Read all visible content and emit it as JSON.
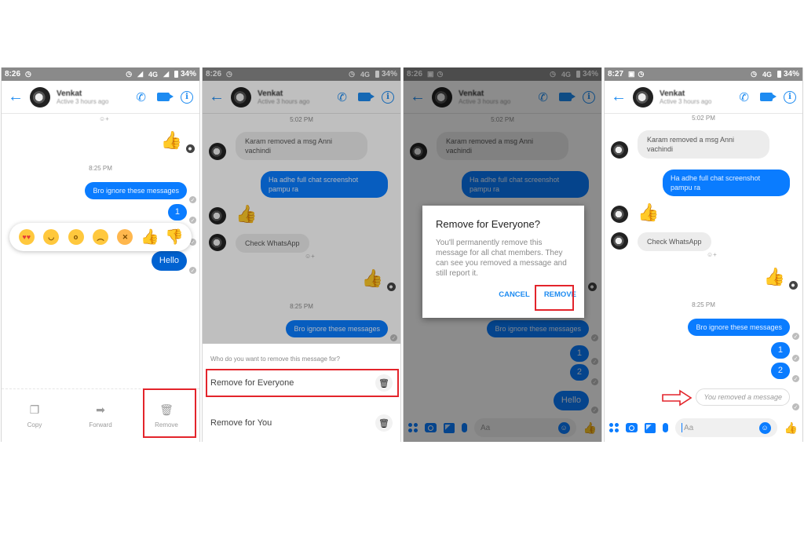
{
  "status_bar": {
    "battery": "34%",
    "network": "4G"
  },
  "contact": {
    "name": "Venkat",
    "status": "Active 3 hours ago"
  },
  "messages": {
    "time_1": "5:02 PM",
    "time_2": "8:25 PM",
    "incoming_1": "Karam removed a msg Anni vachindi",
    "outgoing_1": "Ha adhe full chat screenshot pampu ra",
    "incoming_2": "Check WhatsApp",
    "outgoing_2": "Bro ignore these messages",
    "outgoing_3": "1",
    "outgoing_4": "2",
    "outgoing_5": "Hello",
    "removed_placeholder": "You removed a message"
  },
  "panels": [
    {
      "time": "8:26",
      "reactions": [
        "heart-eyes",
        "laughing",
        "wow",
        "sad",
        "angry",
        "thumbs-up",
        "thumbs-down"
      ],
      "actions": [
        {
          "label": "Copy",
          "icon": "copy-icon"
        },
        {
          "label": "Forward",
          "icon": "forward-icon"
        },
        {
          "label": "Remove",
          "icon": "trash-icon",
          "highlighted": true
        }
      ]
    },
    {
      "time": "8:26",
      "sheet_question": "Who do you want to remove this message for?",
      "options": [
        {
          "label": "Remove for Everyone",
          "highlighted": true
        },
        {
          "label": "Remove for You"
        }
      ]
    },
    {
      "time": "8:26",
      "dialog": {
        "title": "Remove for Everyone?",
        "body": "You'll permanently remove this message for all chat members. They can see you removed a message and still report it.",
        "cancel": "CANCEL",
        "confirm": "REMOVE"
      },
      "composer_placeholder": "Aa"
    },
    {
      "time": "8:27",
      "composer_placeholder": "Aa"
    }
  ],
  "colors": {
    "messenger_blue": "#0a7cff",
    "highlight_red": "#e3242b"
  }
}
